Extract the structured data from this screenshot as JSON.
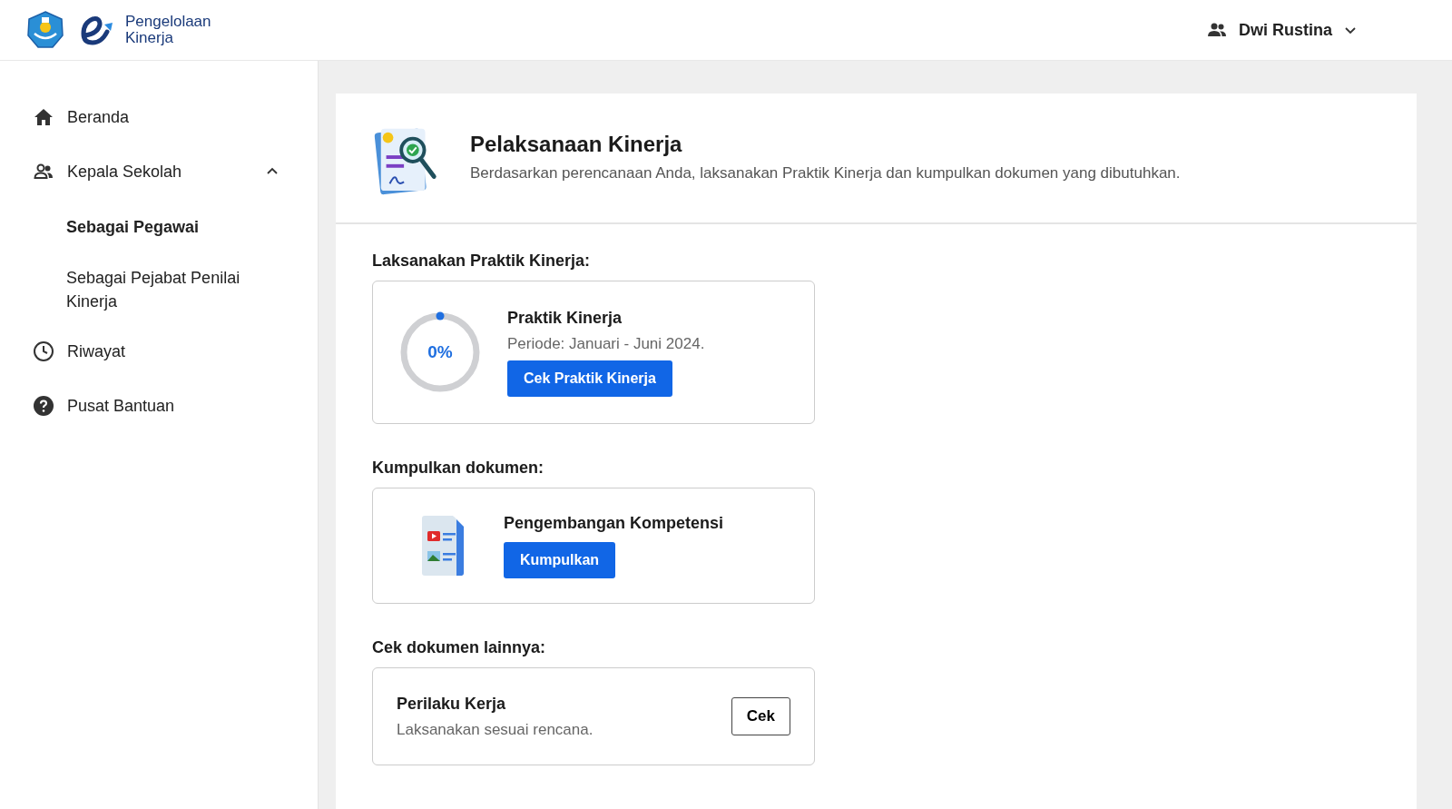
{
  "header": {
    "app_name": [
      "Pengelolaan",
      "Kinerja"
    ],
    "user": {
      "name": "Dwi Rustina",
      "expanded": false
    }
  },
  "sidebar": {
    "items": [
      {
        "kind": "home",
        "label": "Beranda",
        "selected": false
      },
      {
        "kind": "users",
        "label": "Kepala Sekolah",
        "expanded": true,
        "children": [
          {
            "label": "Sebagai Pegawai",
            "selected": true
          },
          {
            "label": "Sebagai Pejabat Penilai Kinerja",
            "selected": false
          }
        ]
      },
      {
        "kind": "clock",
        "label": "Riwayat",
        "selected": false
      },
      {
        "kind": "help",
        "label": "Pusat Bantuan",
        "selected": false
      }
    ]
  },
  "page": {
    "title": "Pelaksanaan Kinerja",
    "subtitle": "Berdasarkan perencanaan Anda, laksanakan Praktik Kinerja dan kumpulkan dokumen yang dibutuhkan.",
    "sections": [
      {
        "kind": "progress",
        "heading": "Laksanakan Praktik Kinerja:",
        "title": "Praktik Kinerja",
        "percent": "0%",
        "period": "Periode: Januari - Juni 2024.",
        "button": "Cek Praktik Kinerja"
      },
      {
        "kind": "upload",
        "heading": "Kumpulkan dokumen:",
        "title": "Pengembangan Kompetensi",
        "button": "Kumpulkan"
      },
      {
        "kind": "check",
        "heading": "Cek dokumen lainnya:",
        "title": "Perilaku Kerja",
        "description": "Laksanakan sesuai rencana.",
        "button": "Cek"
      }
    ]
  }
}
